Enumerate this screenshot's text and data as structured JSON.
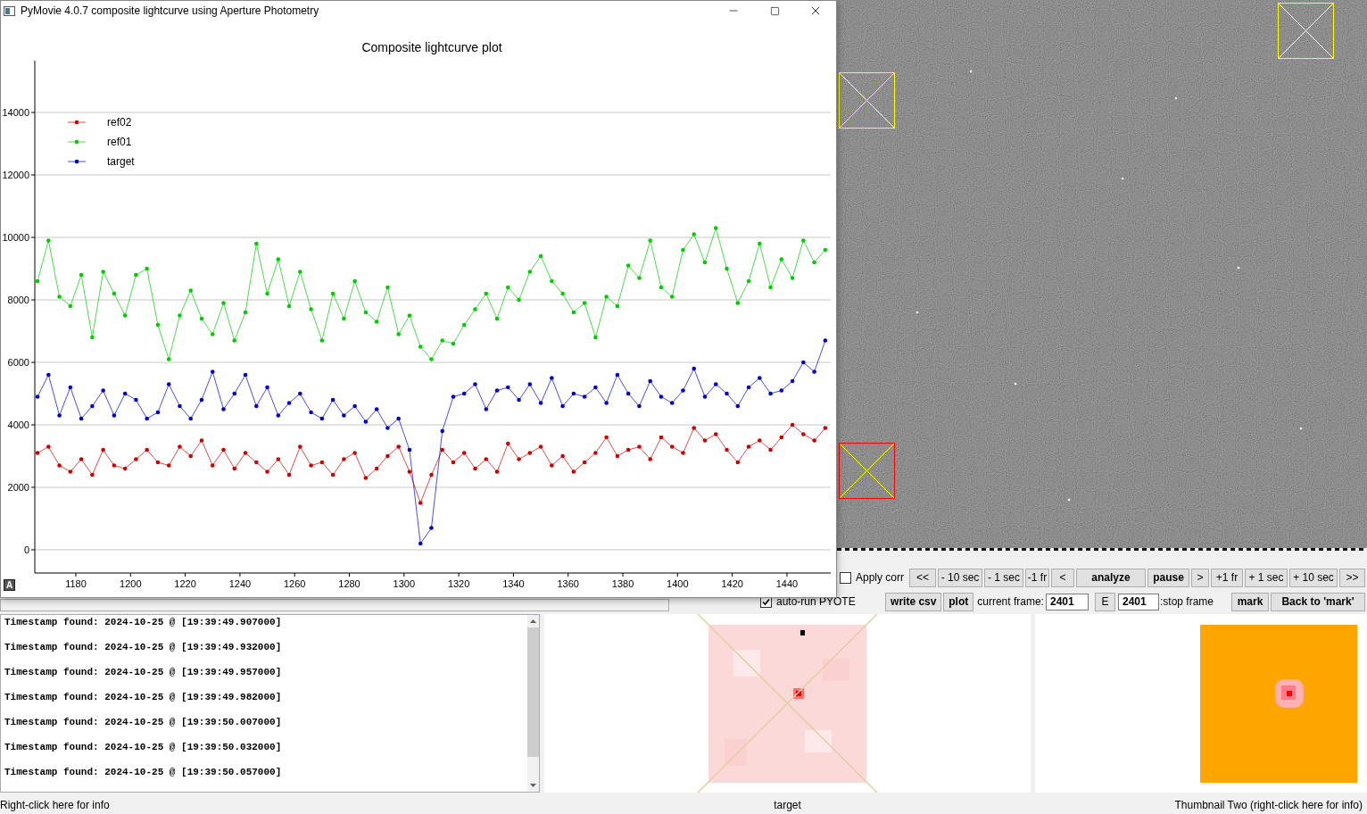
{
  "window": {
    "title": "PyMovie 4.0.7 composite lightcurve using Aperture Photometry"
  },
  "plot": {
    "autoscale_button": "A",
    "chart_data": {
      "type": "line",
      "title": "Composite lightcurve plot",
      "grid": true,
      "legend": "upper left",
      "xlim": [
        1165,
        1456
      ],
      "ylim": [
        -743,
        15657
      ],
      "xticks": [
        1180,
        1200,
        1220,
        1240,
        1260,
        1280,
        1300,
        1320,
        1340,
        1360,
        1380,
        1400,
        1420,
        1440
      ],
      "yticks": [
        0,
        2000,
        4000,
        6000,
        8000,
        10000,
        12000,
        14000
      ],
      "x": [
        1166,
        1170,
        1174,
        1178,
        1182,
        1186,
        1190,
        1194,
        1198,
        1202,
        1206,
        1210,
        1214,
        1218,
        1222,
        1226,
        1230,
        1234,
        1238,
        1242,
        1246,
        1250,
        1254,
        1258,
        1262,
        1266,
        1270,
        1274,
        1278,
        1282,
        1286,
        1290,
        1294,
        1298,
        1302,
        1306,
        1310,
        1314,
        1318,
        1322,
        1326,
        1330,
        1334,
        1338,
        1342,
        1346,
        1350,
        1354,
        1358,
        1362,
        1366,
        1370,
        1374,
        1378,
        1382,
        1386,
        1390,
        1394,
        1398,
        1402,
        1406,
        1410,
        1414,
        1418,
        1422,
        1426,
        1430,
        1434,
        1438,
        1442,
        1446,
        1450,
        1454
      ],
      "series": [
        {
          "name": "ref02",
          "color": "#cc0000",
          "values": [
            3100,
            3300,
            2700,
            2500,
            2900,
            2400,
            3200,
            2700,
            2600,
            2900,
            3200,
            2800,
            2700,
            3300,
            3000,
            3500,
            2700,
            3200,
            2600,
            3100,
            2800,
            2500,
            2900,
            2400,
            3300,
            2700,
            2800,
            2400,
            2900,
            3100,
            2300,
            2600,
            3000,
            3300,
            2500,
            1500,
            2400,
            3200,
            2800,
            3100,
            2600,
            2900,
            2500,
            3400,
            2900,
            3100,
            3300,
            2700,
            3000,
            2500,
            2800,
            3100,
            3600,
            3000,
            3200,
            3300,
            2900,
            3600,
            3300,
            3100,
            3900,
            3500,
            3700,
            3200,
            2800,
            3300,
            3500,
            3200,
            3600,
            4000,
            3700,
            3500,
            3900
          ]
        },
        {
          "name": "ref01",
          "color": "#00cc00",
          "values": [
            8600,
            9900,
            8100,
            7800,
            8800,
            6800,
            8900,
            8200,
            7500,
            8800,
            9000,
            7200,
            6100,
            7500,
            8300,
            7400,
            6900,
            7900,
            6700,
            7600,
            9800,
            8200,
            9300,
            7800,
            8900,
            7700,
            6700,
            8200,
            7400,
            8600,
            7600,
            7300,
            8400,
            6900,
            7500,
            6500,
            6100,
            6700,
            6600,
            7200,
            7700,
            8200,
            7400,
            8400,
            8000,
            8900,
            9400,
            8600,
            8200,
            7600,
            7900,
            6800,
            8100,
            7800,
            9100,
            8700,
            9900,
            8400,
            8100,
            9600,
            10100,
            9200,
            10300,
            9000,
            7900,
            8600,
            9800,
            8400,
            9300,
            8700,
            9900,
            9200,
            9600
          ]
        },
        {
          "name": "target",
          "color": "#0000cc",
          "values": [
            4900,
            5600,
            4300,
            5200,
            4200,
            4600,
            5100,
            4300,
            5000,
            4800,
            4200,
            4400,
            5300,
            4600,
            4200,
            4800,
            5700,
            4500,
            5000,
            5600,
            4600,
            5200,
            4300,
            4700,
            5000,
            4400,
            4200,
            4800,
            4300,
            4600,
            4100,
            4500,
            3900,
            4200,
            3200,
            200,
            700,
            3800,
            4900,
            5000,
            5300,
            4500,
            5100,
            5200,
            4800,
            5300,
            4700,
            5500,
            4600,
            5000,
            4900,
            5200,
            4700,
            5600,
            5000,
            4600,
            5400,
            4900,
            4700,
            5100,
            5800,
            4900,
            5300,
            5000,
            4600,
            5200,
            5500,
            5000,
            5100,
            5400,
            6000,
            5700,
            6700
          ]
        }
      ]
    }
  },
  "star_image": {
    "kind": "picture",
    "apertures": [
      {
        "color": "#ffff00"
      },
      {
        "color": "#ffff00"
      },
      {
        "color": "#ff0000"
      }
    ]
  },
  "controls": {
    "apply_corr": {
      "label": "Apply corr",
      "checked": false
    },
    "playback_buttons": [
      {
        "label": "<<",
        "bold": false
      },
      {
        "label": "- 10 sec",
        "bold": false
      },
      {
        "label": "- 1 sec",
        "bold": false
      },
      {
        "label": "-1 fr",
        "bold": false
      },
      {
        "label": "<",
        "bold": false
      },
      {
        "label": "analyze",
        "bold": true
      },
      {
        "label": "pause",
        "bold": true
      },
      {
        "label": ">",
        "bold": false
      },
      {
        "label": "+1 fr",
        "bold": false
      },
      {
        "label": "+ 1 sec",
        "bold": false
      },
      {
        "label": "+ 10 sec",
        "bold": false
      },
      {
        "label": ">>",
        "bold": false
      }
    ],
    "auto_run": {
      "label": "auto-run PYOTE",
      "checked": true
    },
    "output_buttons": [
      {
        "label": "write csv",
        "bold": true
      },
      {
        "label": "plot",
        "bold": true
      }
    ],
    "current_frame": {
      "label": "current frame:",
      "value": "2401"
    },
    "e_button": "E",
    "stop_frame": {
      "value": "2401",
      "label": ":stop frame"
    },
    "mark_buttons": [
      {
        "label": "mark",
        "bold": true
      },
      {
        "label": "Back to 'mark'",
        "bold": true
      }
    ]
  },
  "log": {
    "lines": [
      "Timestamp found: 2024-10-25 @ [19:39:49.907000]",
      "Timestamp found: 2024-10-25 @ [19:39:49.932000]",
      "Timestamp found: 2024-10-25 @ [19:39:49.957000]",
      "Timestamp found: 2024-10-25 @ [19:39:49.982000]",
      "Timestamp found: 2024-10-25 @ [19:39:50.007000]",
      "Timestamp found: 2024-10-25 @ [19:39:50.032000]",
      "Timestamp found: 2024-10-25 @ [19:39:50.057000]"
    ]
  },
  "status_labels": [
    "Right-click here for info",
    "target",
    "Thumbnail Two (right-click here for info)"
  ]
}
